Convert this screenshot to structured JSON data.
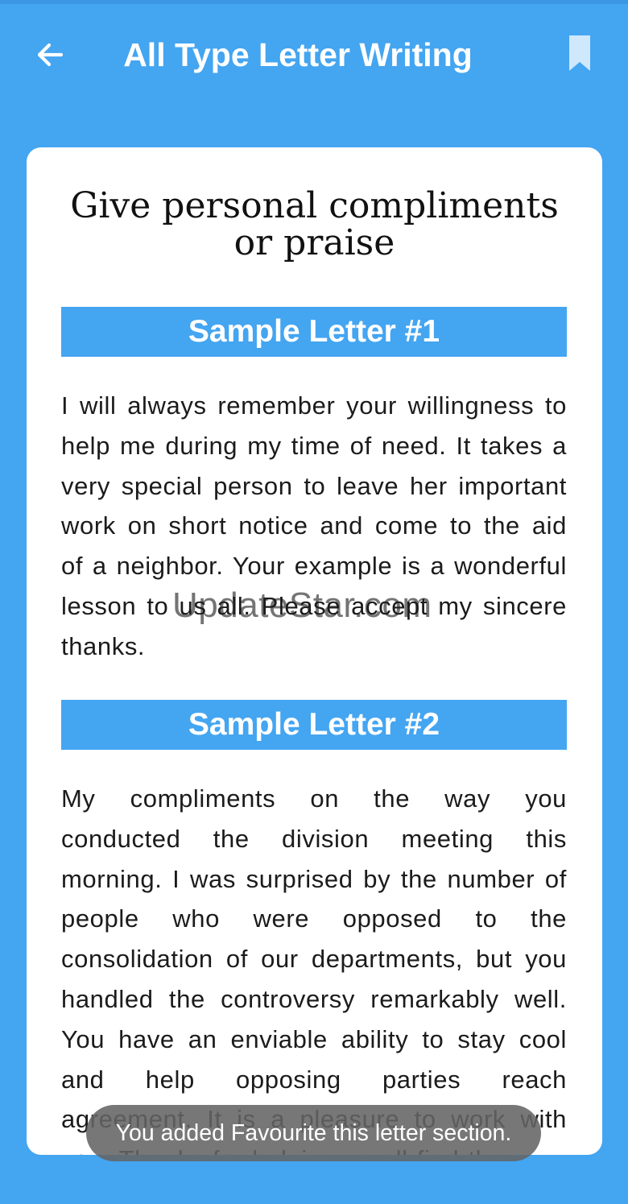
{
  "app_bar": {
    "title": "All Type Letter Writing",
    "back_icon": "arrow-back-icon",
    "bookmark_icon": "bookmark-icon"
  },
  "letter": {
    "title": "Give personal compliments or praise",
    "sections": [
      {
        "header": "Sample Letter #1",
        "body": "I will always remember your willingness to help me during my time of need. It takes a very special person to leave her important work on short notice and come to the aid of a neighbor. Your example is a wonderful lesson to us all. Please accept my sincere thanks."
      },
      {
        "header": "Sample Letter #2",
        "body": "My compliments on the way you conducted the division meeting this morning. I was surprised by the number of people who were opposed to the consolidation of our departments, but you handled the controversy remarkably well. You have an enviable ability to stay cool and help opposing parties reach agreement. It is a pleasure to work with you. Thanks for helping us all find the"
      }
    ]
  },
  "watermark": "UpdateStar.com",
  "toast": {
    "message": "You added Favourite this letter section."
  },
  "colors": {
    "primary": "#44a5f1",
    "card": "#ffffff",
    "text": "#1b1b1b",
    "toast": "#646464"
  }
}
